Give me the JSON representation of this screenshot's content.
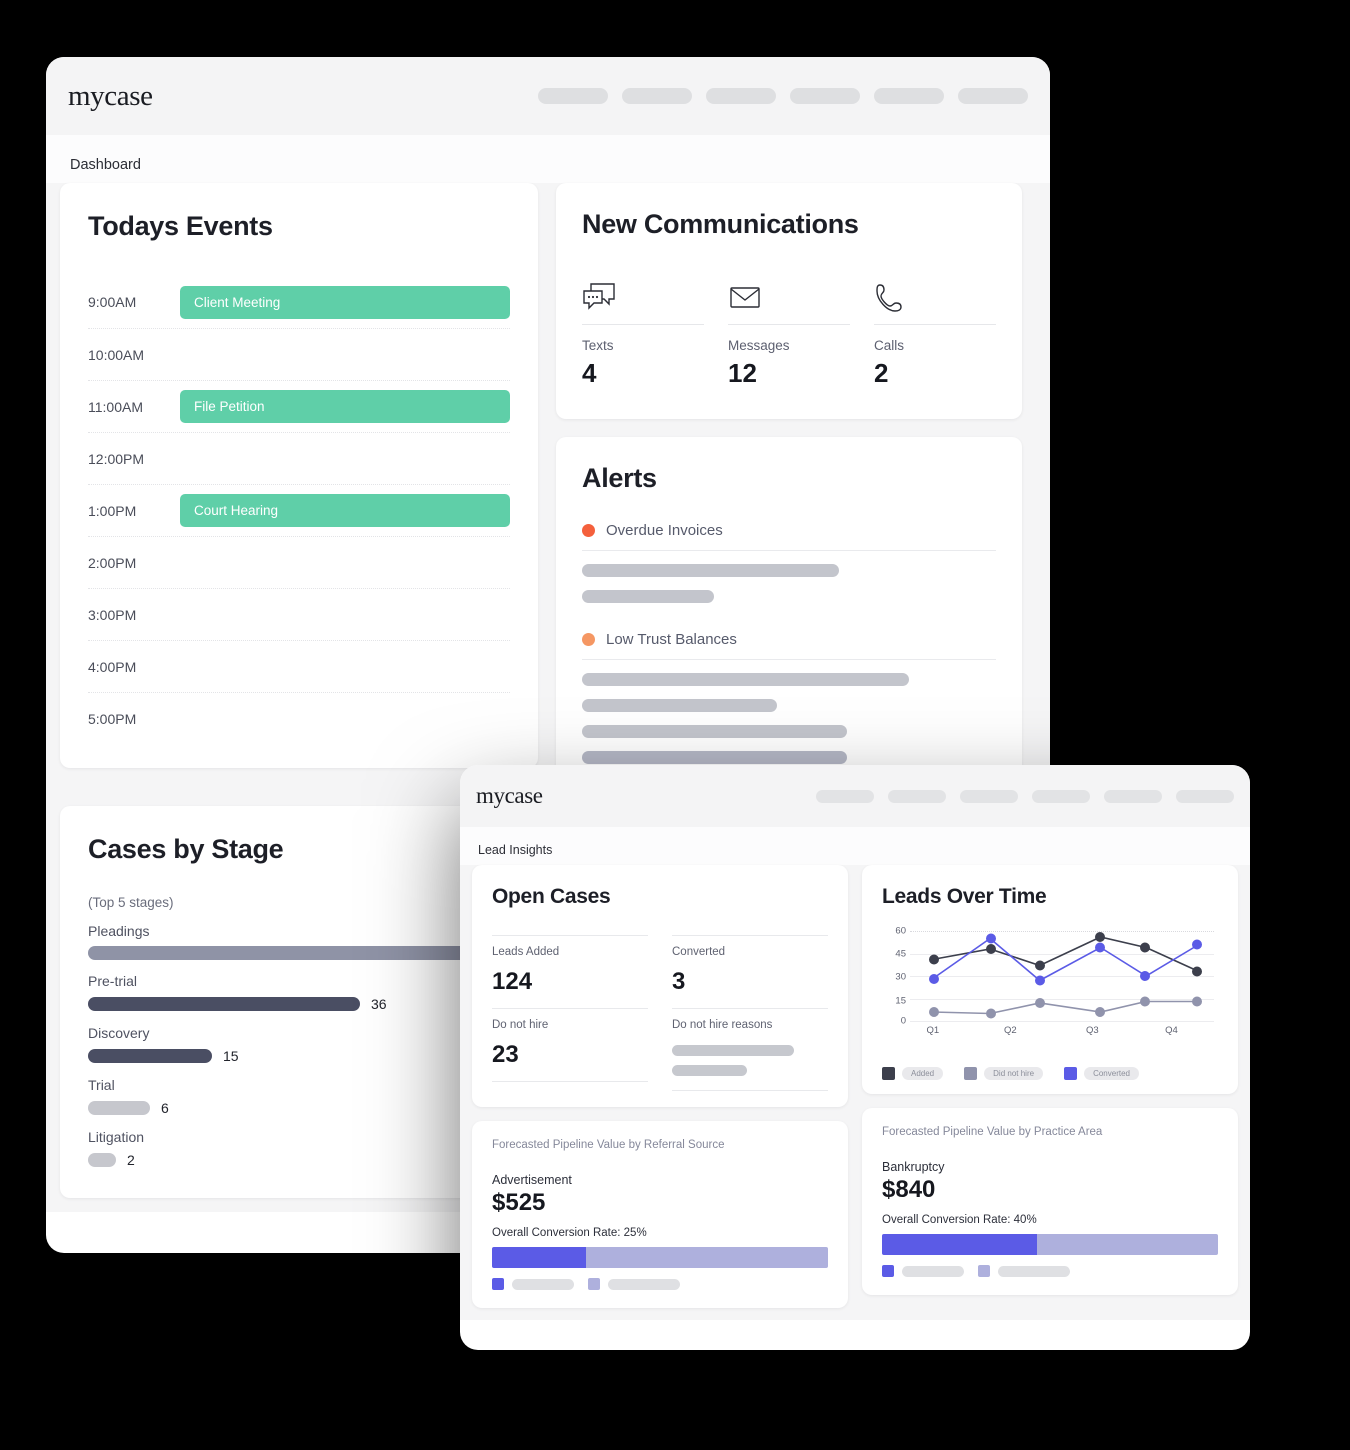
{
  "colors": {
    "event_green": "#5fcfa8",
    "alert_red": "#f4603c",
    "alert_orange": "#f59763",
    "series_added": "#3c3f4c",
    "series_didnothire": "#9093ac",
    "series_converted": "#5b5be6",
    "pipeline_fill": "#5b5be6",
    "pipeline_track": "#aeb0dd",
    "stage_bar_light": "#c6c7cd",
    "stage_bar_mid": "#8f93a6",
    "stage_bar_dark": "#4a4e63"
  },
  "window_back": {
    "logo": "mycase",
    "breadcrumb": "Dashboard",
    "nav_pill_widths": [
      70,
      70,
      70,
      70,
      70,
      70
    ],
    "events": {
      "title": "Todays Events",
      "rows": [
        {
          "time": "9:00AM",
          "label": "Client Meeting"
        },
        {
          "time": "10:00AM",
          "label": ""
        },
        {
          "time": "11:00AM",
          "label": "File Petition"
        },
        {
          "time": "12:00PM",
          "label": ""
        },
        {
          "time": "1:00PM",
          "label": "Court Hearing"
        },
        {
          "time": "2:00PM",
          "label": ""
        },
        {
          "time": "3:00PM",
          "label": ""
        },
        {
          "time": "4:00PM",
          "label": ""
        },
        {
          "time": "5:00PM",
          "label": ""
        }
      ]
    },
    "communications": {
      "title": "New Communications",
      "items": [
        {
          "icon": "chat-bubbles-icon",
          "label": "Texts",
          "value": "4"
        },
        {
          "icon": "envelope-icon",
          "label": "Messages",
          "value": "12"
        },
        {
          "icon": "phone-icon",
          "label": "Calls",
          "value": "2"
        }
      ]
    },
    "alerts": {
      "title": "Alerts",
      "groups": [
        {
          "label": "Overdue Invoices",
          "dot_color": "#f4603c",
          "skeleton_widths": [
            62,
            32
          ]
        },
        {
          "label": "Low Trust Balances",
          "dot_color": "#f59763",
          "skeleton_widths": [
            79,
            47,
            64,
            64
          ]
        }
      ]
    },
    "cases_by_stage": {
      "title": "Cases by Stage",
      "subtitle": "(Top 5 stages)",
      "stages": [
        {
          "name": "Pleadings",
          "value": "",
          "bar_pct": 100,
          "color": "#8f93a6"
        },
        {
          "name": "Pre-trial",
          "value": "36",
          "bar_pct": 64,
          "color": "#4a4e63"
        },
        {
          "name": "Discovery",
          "value": "15",
          "bar_pct": 29,
          "color": "#4a4e63"
        },
        {
          "name": "Trial",
          "value": "6",
          "bar_pct": 15,
          "color": "#c6c7cd"
        },
        {
          "name": "Litigation",
          "value": "2",
          "bar_pct": 6,
          "color": "#c6c7cd"
        }
      ]
    }
  },
  "window_front": {
    "logo": "mycase",
    "breadcrumb": "Lead Insights",
    "nav_pill_widths": [
      58,
      58,
      58,
      58,
      58,
      58
    ],
    "open_cases": {
      "title": "Open Cases",
      "metrics": [
        {
          "label": "Leads Added",
          "value": "124"
        },
        {
          "label": "Converted",
          "value": "3"
        },
        {
          "label": "Do not hire",
          "value": "23"
        },
        {
          "label": "Do not hire reasons",
          "value": "",
          "skeleton_widths": [
            78,
            48
          ]
        }
      ]
    },
    "pipeline_referral": {
      "title": "Forecasted Pipeline Value by Referral Source",
      "name": "Advertisement",
      "amount": "$525",
      "rate_label": "Overall Conversion Rate: 25%",
      "fill_pct": 28,
      "legend_chip_widths": [
        62,
        52
      ]
    },
    "pipeline_practice": {
      "title": "Forecasted Pipeline Value by Practice Area",
      "name": "Bankruptcy",
      "amount": "$840",
      "rate_label": "Overall Conversion Rate: 40%",
      "fill_pct": 46,
      "legend_chip_widths": [
        62,
        62
      ]
    }
  },
  "chart_data": {
    "type": "line",
    "title": "Leads Over Time",
    "xlabel": "",
    "ylabel": "",
    "ylim": [
      0,
      60
    ],
    "yticks": [
      0,
      15,
      30,
      45,
      60
    ],
    "grid": true,
    "legend_position": "bottom",
    "categories": [
      "Q1",
      "",
      "Q2",
      "",
      "Q3",
      "",
      "Q4",
      ""
    ],
    "x": [
      0,
      1,
      2,
      3,
      4,
      5,
      6,
      7
    ],
    "xtick_labels": [
      "Q1",
      "Q2",
      "Q3",
      "Q4"
    ],
    "xtick_positions": [
      0,
      2,
      4,
      6
    ],
    "series": [
      {
        "name": "Added",
        "color": "#3c3f4c",
        "values": [
          41,
          48,
          37,
          56,
          49,
          33
        ]
      },
      {
        "name": "Did not hire",
        "color": "#9093ac",
        "values": [
          6,
          5,
          12,
          6,
          13,
          13
        ]
      },
      {
        "name": "Converted",
        "color": "#5b5be6",
        "values": [
          28,
          55,
          27,
          49,
          30,
          51
        ]
      }
    ],
    "series_x": [
      0.6,
      2.1,
      3.4,
      5.0,
      6.2,
      7.6
    ]
  }
}
